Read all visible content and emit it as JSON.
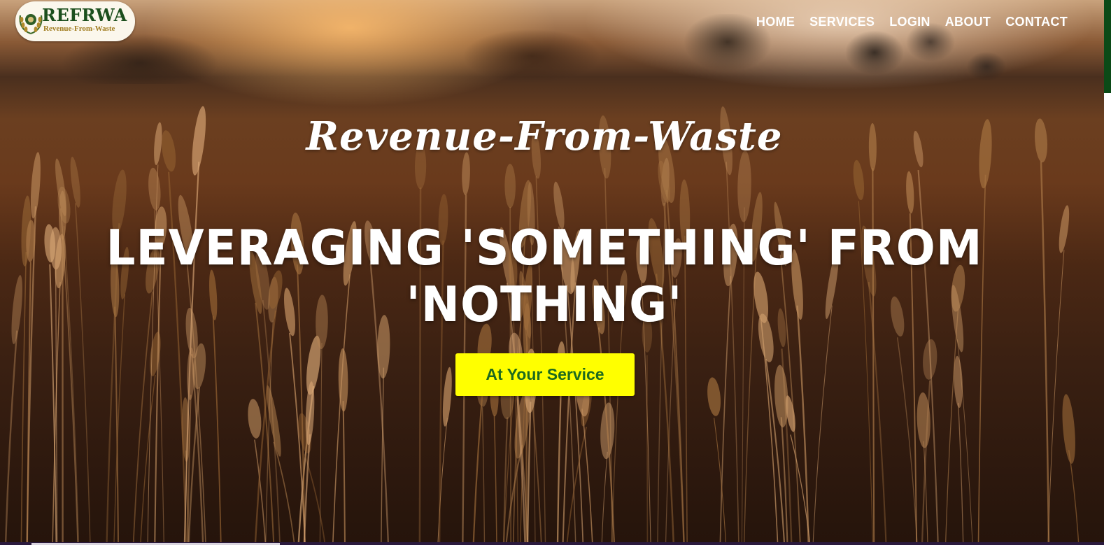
{
  "brand": {
    "logo_text": "REFRWA",
    "logo_subtitle": "Revenue-From-Waste"
  },
  "nav": {
    "items": [
      {
        "label": "HOME"
      },
      {
        "label": "SERVICES"
      },
      {
        "label": "LOGIN"
      },
      {
        "label": "ABOUT"
      },
      {
        "label": "CONTACT"
      }
    ]
  },
  "hero": {
    "script_title": "Revenue-From-Waste",
    "headline": "LEVERAGING 'SOMETHING' FROM 'NOTHING'",
    "cta_label": "At Your Service"
  },
  "colors": {
    "cta_background": "#ffff00",
    "cta_text": "#1e6a1e",
    "logo_green": "#1c4f1d",
    "nav_text": "#ffffff"
  }
}
